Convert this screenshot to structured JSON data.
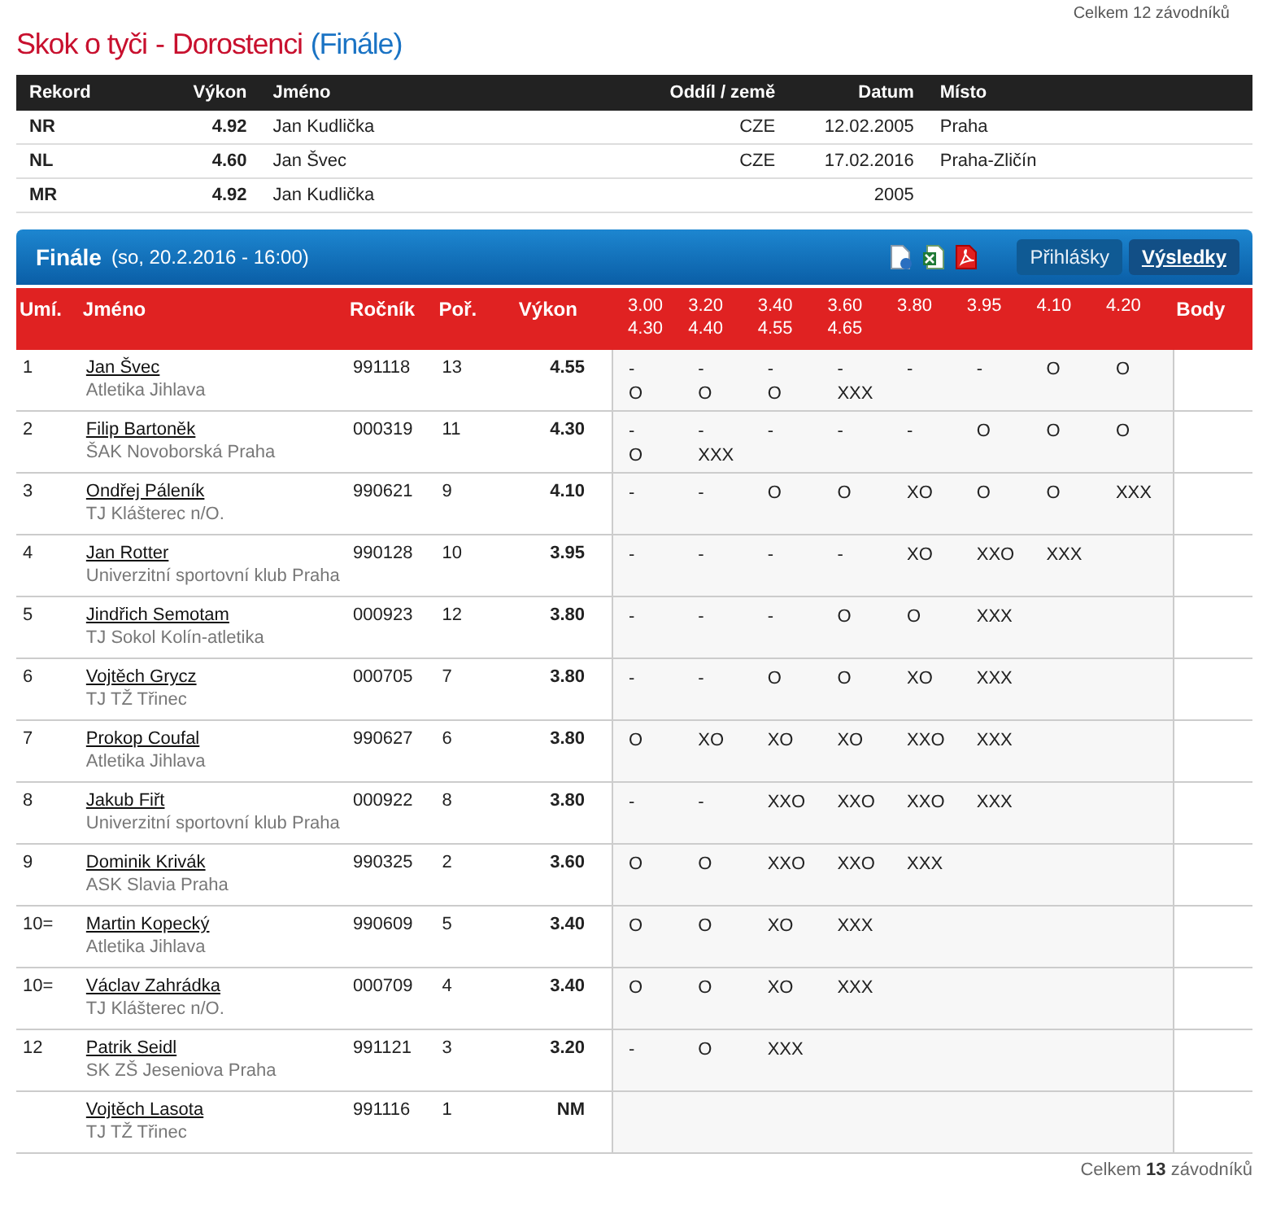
{
  "top_note": "Celkem 12 závodníků",
  "title": {
    "discipline": "Skok o tyči",
    "separator": "-",
    "category": "Dorostenci",
    "round": "(Finále)"
  },
  "records": {
    "columns": [
      "Rekord",
      "Výkon",
      "Jméno",
      "Oddíl / země",
      "Datum",
      "Místo"
    ],
    "rows": [
      {
        "record": "NR",
        "result": "4.92",
        "name": "Jan Kudlička",
        "club": "CZE",
        "date": "12.02.2005",
        "place": "Praha"
      },
      {
        "record": "NL",
        "result": "4.60",
        "name": "Jan Švec",
        "club": "CZE",
        "date": "17.02.2016",
        "place": "Praha-Zličín"
      },
      {
        "record": "MR",
        "result": "4.92",
        "name": "Jan Kudlička",
        "date": "2005"
      }
    ]
  },
  "panel": {
    "title": "Finále",
    "subtitle": "(so, 20.2.2016 - 16:00)",
    "tabs": [
      {
        "label": "Přihlášky",
        "selected": false
      },
      {
        "label": "Výsledky",
        "selected": true
      }
    ]
  },
  "results": {
    "columns": [
      "Umí.",
      "Jméno",
      "Ročník",
      "Poř.",
      "Výkon",
      "Body"
    ],
    "heights": [
      [
        "3.00",
        "4.30"
      ],
      [
        "3.20",
        "4.40"
      ],
      [
        "3.40",
        "4.55"
      ],
      [
        "3.60",
        "4.65"
      ],
      [
        "3.80"
      ],
      [
        "3.95"
      ],
      [
        "4.10"
      ],
      [
        "4.20"
      ]
    ],
    "rows": [
      {
        "place": "1",
        "name": "Jan Švec",
        "club": "Atletika Jihlava",
        "born": "991118",
        "order": "13",
        "result": "4.55",
        "attempts": [
          [
            "-",
            "O"
          ],
          [
            "-",
            "O"
          ],
          [
            "-",
            "O"
          ],
          [
            "-",
            "XXX"
          ],
          [
            "-"
          ],
          [
            "-"
          ],
          [
            "O"
          ],
          [
            "O"
          ]
        ]
      },
      {
        "place": "2",
        "name": "Filip Bartoněk",
        "club": "ŠAK Novoborská Praha",
        "born": "000319",
        "order": "11",
        "result": "4.30",
        "attempts": [
          [
            "-",
            "O"
          ],
          [
            "-",
            "XXX"
          ],
          [
            "-"
          ],
          [
            "-"
          ],
          [
            "-"
          ],
          [
            "O"
          ],
          [
            "O"
          ],
          [
            "O"
          ]
        ]
      },
      {
        "place": "3",
        "name": "Ondřej Páleník",
        "club": "TJ Klášterec n/O.",
        "born": "990621",
        "order": "9",
        "result": "4.10",
        "attempts": [
          [
            "-"
          ],
          [
            "-"
          ],
          [
            "O"
          ],
          [
            "O"
          ],
          [
            "XO"
          ],
          [
            "O"
          ],
          [
            "O"
          ],
          [
            "XXX"
          ]
        ]
      },
      {
        "place": "4",
        "name": "Jan Rotter",
        "club": "Univerzitní sportovní klub Praha",
        "born": "990128",
        "order": "10",
        "result": "3.95",
        "attempts": [
          [
            "-"
          ],
          [
            "-"
          ],
          [
            "-"
          ],
          [
            "-"
          ],
          [
            "XO"
          ],
          [
            "XXO"
          ],
          [
            "XXX"
          ]
        ]
      },
      {
        "place": "5",
        "name": "Jindřich Semotam",
        "club": "TJ Sokol Kolín-atletika",
        "born": "000923",
        "order": "12",
        "result": "3.80",
        "attempts": [
          [
            "-"
          ],
          [
            "-"
          ],
          [
            "-"
          ],
          [
            "O"
          ],
          [
            "O"
          ],
          [
            "XXX"
          ]
        ]
      },
      {
        "place": "6",
        "name": "Vojtěch Grycz",
        "club": "TJ TŽ Třinec",
        "born": "000705",
        "order": "7",
        "result": "3.80",
        "attempts": [
          [
            "-"
          ],
          [
            "-"
          ],
          [
            "O"
          ],
          [
            "O"
          ],
          [
            "XO"
          ],
          [
            "XXX"
          ]
        ]
      },
      {
        "place": "7",
        "name": "Prokop Coufal",
        "club": "Atletika Jihlava",
        "born": "990627",
        "order": "6",
        "result": "3.80",
        "attempts": [
          [
            "O"
          ],
          [
            "XO"
          ],
          [
            "XO"
          ],
          [
            "XO"
          ],
          [
            "XXO"
          ],
          [
            "XXX"
          ]
        ]
      },
      {
        "place": "8",
        "name": "Jakub Fiřt",
        "club": "Univerzitní sportovní klub Praha",
        "born": "000922",
        "order": "8",
        "result": "3.80",
        "attempts": [
          [
            "-"
          ],
          [
            "-"
          ],
          [
            "XXO"
          ],
          [
            "XXO"
          ],
          [
            "XXO"
          ],
          [
            "XXX"
          ]
        ]
      },
      {
        "place": "9",
        "name": "Dominik Krivák",
        "club": "ASK Slavia Praha",
        "born": "990325",
        "order": "2",
        "result": "3.60",
        "attempts": [
          [
            "O"
          ],
          [
            "O"
          ],
          [
            "XXO"
          ],
          [
            "XXO"
          ],
          [
            "XXX"
          ]
        ]
      },
      {
        "place": "10=",
        "name": "Martin Kopecký",
        "club": "Atletika Jihlava",
        "born": "990609",
        "order": "5",
        "result": "3.40",
        "attempts": [
          [
            "O"
          ],
          [
            "O"
          ],
          [
            "XO"
          ],
          [
            "XXX"
          ]
        ]
      },
      {
        "place": "10=",
        "name": "Václav Zahrádka",
        "club": "TJ Klášterec n/O.",
        "born": "000709",
        "order": "4",
        "result": "3.40",
        "attempts": [
          [
            "O"
          ],
          [
            "O"
          ],
          [
            "XO"
          ],
          [
            "XXX"
          ]
        ]
      },
      {
        "place": "12",
        "name": "Patrik Seidl",
        "club": "SK ZŠ Jeseniova Praha",
        "born": "991121",
        "order": "3",
        "result": "3.20",
        "attempts": [
          [
            "-"
          ],
          [
            "O"
          ],
          [
            "XXX"
          ]
        ]
      },
      {
        "name": "Vojtěch Lasota",
        "club": "TJ TŽ Třinec",
        "born": "991116",
        "order": "1",
        "result": "NM"
      }
    ]
  },
  "footer": {
    "label": "Celkem",
    "count": "13",
    "unit": "závodníků"
  }
}
